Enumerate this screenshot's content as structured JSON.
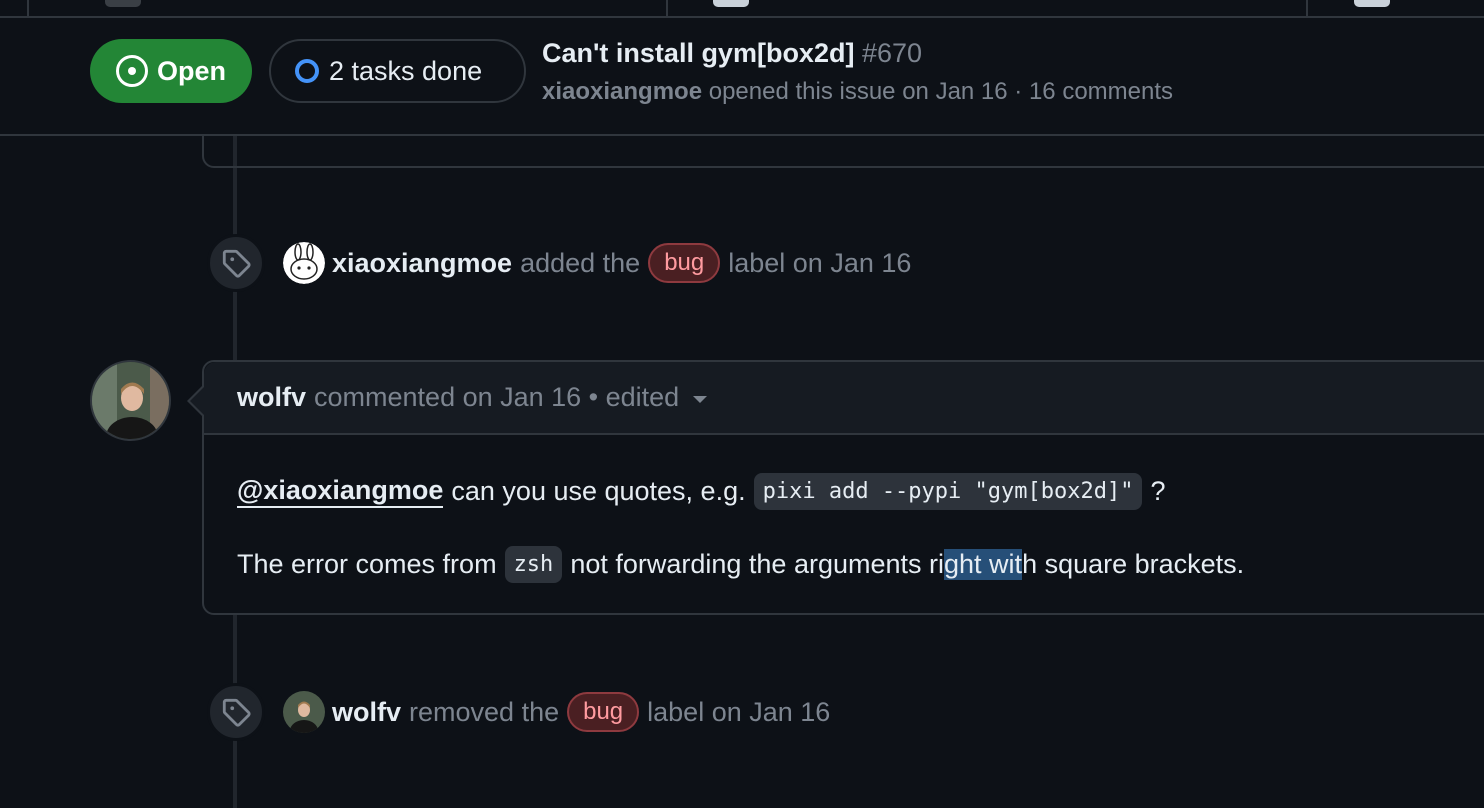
{
  "issue": {
    "state_label": "Open",
    "tasks_label": "2 tasks done",
    "title": "Can't install gym[box2d]",
    "number": "#670",
    "author": "xiaoxiangmoe",
    "meta_text": "opened this issue on Jan 16 · 16 comments"
  },
  "events": [
    {
      "actor": "xiaoxiangmoe",
      "verb": "added the",
      "label": "bug",
      "suffix": "label on Jan 16"
    },
    {
      "actor": "wolfv",
      "verb": "removed the",
      "label": "bug",
      "suffix": "label on Jan 16"
    }
  ],
  "comment": {
    "author": "wolfv",
    "meta": "commented on Jan 16 • edited",
    "mention": "@xiaoxiangmoe",
    "p1_text": "can you use quotes, e.g.",
    "p1_code": "pixi add --pypi \"gym[box2d]\"",
    "p1_end": "?",
    "p2_start": "The error comes from",
    "p2_code": "zsh",
    "p2_mid": "not forwarding the arguments ri",
    "p2_selected": "ght wit",
    "p2_end": "h square brackets."
  },
  "icons": {
    "state": "issue-opened-icon",
    "tasks": "task-progress-icon",
    "event": "tag-icon",
    "menu": "chevron-down-icon"
  },
  "colors": {
    "open_green": "#238636",
    "label_bug_bg": "#4a1f22",
    "label_bug_text": "#ff9ba0",
    "progress_blue": "#4493f8"
  }
}
